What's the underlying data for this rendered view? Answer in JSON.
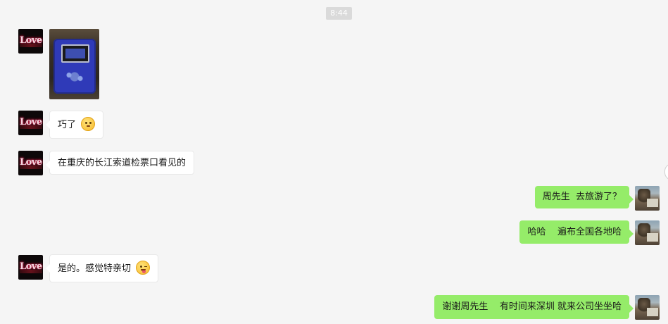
{
  "timestamp": "8:44",
  "messages": [
    {
      "side": "left",
      "type": "image",
      "image_desc": "blue device"
    },
    {
      "side": "left",
      "type": "text",
      "text": "巧了",
      "emoji": "thinking-face-emoji"
    },
    {
      "side": "left",
      "type": "text",
      "text": "在重庆的长江索道检票口看见的"
    },
    {
      "side": "right",
      "type": "text",
      "text": "周先生  去旅游了？"
    },
    {
      "side": "right",
      "type": "text",
      "text": "哈哈    遍布全国各地哈"
    },
    {
      "side": "left",
      "type": "text",
      "text": "是的。感觉特亲切",
      "emoji": "tongue-wink-emoji"
    },
    {
      "side": "right",
      "type": "text",
      "text": "谢谢周先生    有时间来深圳 就来公司坐坐哈"
    }
  ],
  "avatar_left_text": "Love",
  "colors": {
    "background": "#f5f5f5",
    "bubble_right": "#95ec69",
    "bubble_left": "#ffffff"
  }
}
